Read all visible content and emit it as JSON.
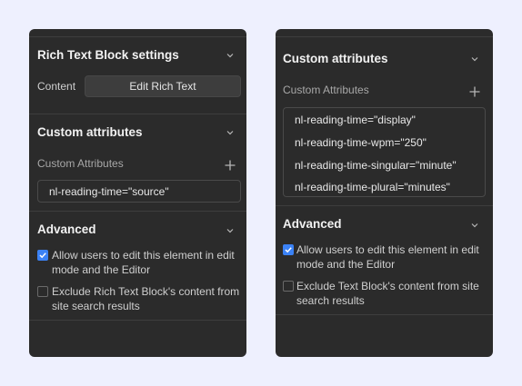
{
  "left_panel": {
    "rich_text": {
      "title": "Rich Text Block settings",
      "content_label": "Content",
      "edit_button": "Edit Rich Text"
    },
    "custom_attributes": {
      "title": "Custom attributes",
      "field_label": "Custom Attributes",
      "items": [
        "nl-reading-time=\"source\""
      ]
    },
    "advanced": {
      "title": "Advanced",
      "checkbox_1": {
        "label_line1": "Allow users to edit this element in edit",
        "label_line2": "mode and the Editor",
        "checked": true
      },
      "checkbox_2": {
        "label_line1": "Exclude Rich Text Block's content from",
        "label_line2": "site search results",
        "checked": false
      }
    }
  },
  "right_panel": {
    "custom_attributes": {
      "title": "Custom attributes",
      "field_label": "Custom Attributes",
      "items": [
        "nl-reading-time=\"display\"",
        "nl-reading-time-wpm=\"250\"",
        "nl-reading-time-singular=\"minute\"",
        "nl-reading-time-plural=\"minutes\""
      ]
    },
    "advanced": {
      "title": "Advanced",
      "checkbox_1": {
        "label_line1": "Allow users to edit this element in edit",
        "label_line2": "mode and the Editor",
        "checked": true
      },
      "checkbox_2": {
        "label_line1": "Exclude Text Block's content from site",
        "label_line2": "search results",
        "checked": false
      }
    }
  },
  "colors": {
    "page_bg": "#eef0fe",
    "panel_bg": "#2b2b2b",
    "checkbox_accent": "#3b82f6"
  },
  "icons": [
    "chevron-down-icon",
    "plus-icon",
    "checkmark-icon"
  ]
}
